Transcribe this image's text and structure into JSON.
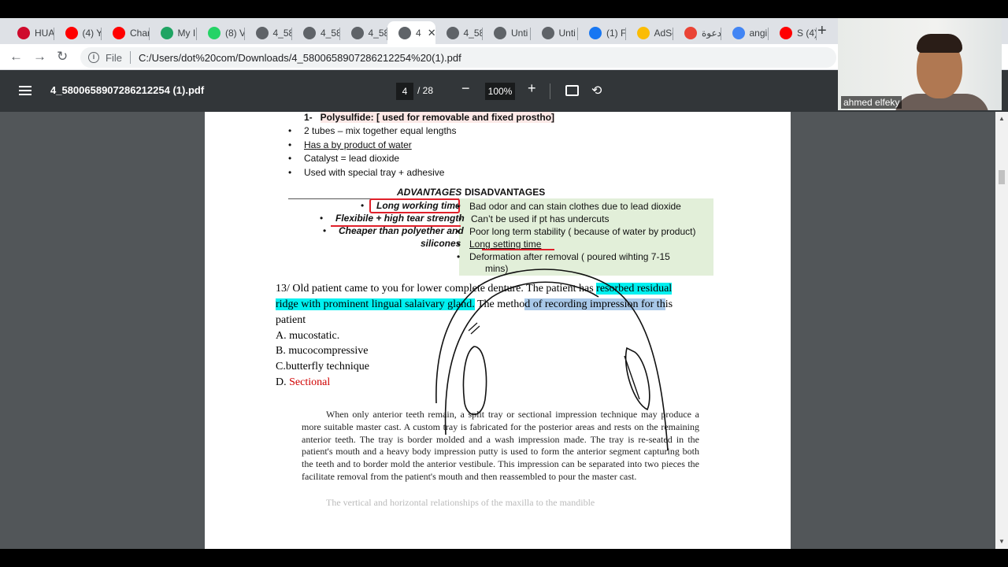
{
  "tabs": [
    {
      "title": "HUA",
      "icon": "huawei-icon",
      "color": "#cf0a2c"
    },
    {
      "title": "(4) Y",
      "icon": "youtube-icon",
      "color": "#ff0000"
    },
    {
      "title": "Char",
      "icon": "youtube-icon",
      "color": "#ff0000"
    },
    {
      "title": "My I",
      "icon": "google-drive-icon",
      "color": "#1fa463"
    },
    {
      "title": "(8) V",
      "icon": "whatsapp-icon",
      "color": "#25d366"
    },
    {
      "title": "4_58",
      "icon": "globe-icon",
      "color": "#5f6368"
    },
    {
      "title": "4_58",
      "icon": "globe-icon",
      "color": "#5f6368"
    },
    {
      "title": "4_58",
      "icon": "globe-icon",
      "color": "#5f6368"
    },
    {
      "title": "4",
      "icon": "globe-icon",
      "color": "#5f6368"
    },
    {
      "title": "4_58",
      "icon": "globe-icon",
      "color": "#5f6368"
    },
    {
      "title": "Unti",
      "icon": "globe-icon",
      "color": "#5f6368"
    },
    {
      "title": "Unti",
      "icon": "globe-icon",
      "color": "#5f6368"
    },
    {
      "title": "(1) F",
      "icon": "facebook-icon",
      "color": "#1877f2"
    },
    {
      "title": "AdSe",
      "icon": "adsense-icon",
      "color": "#fbbc04"
    },
    {
      "title": "دعوة",
      "icon": "gmail-icon",
      "color": "#ea4335"
    },
    {
      "title": "angi",
      "icon": "google-icon",
      "color": "#4285f4"
    },
    {
      "title": "S (4)",
      "icon": "youtube-icon",
      "color": "#ff0000"
    }
  ],
  "address_bar": {
    "scheme_label": "File",
    "url": "C:/Users/dot%20com/Downloads/4_5800658907286212254%20(1).pdf"
  },
  "pdf_toolbar": {
    "title": "4_5800658907286212254 (1).pdf",
    "current_page": "4",
    "total_pages": "/ 28",
    "zoom": "100%"
  },
  "pdf_page": {
    "section_number": "1-",
    "section_title": "Polysulfide: [ used for removable and fixed prostho]",
    "bullets": [
      "2 tubes – mix together equal lengths",
      "Has a by product of water",
      "Catalyst = lead dioxide",
      "Used with special tray + adhesive"
    ],
    "advantages_heading": "ADVANTAGES",
    "disadvantages_heading": "DISADVANTAGES",
    "advantages": [
      "Long working time",
      "Flexibile + high tear strength",
      "Cheaper than polyether and",
      "silicones"
    ],
    "disadvantages": [
      "Bad odor and can stain clothes due to lead dioxide",
      "Can’t be used if pt has undercuts",
      "Poor long term stability ( because of water by product)",
      "Long setting time",
      "Deformation after removal ( poured wihting 7-15",
      "mins)"
    ],
    "question": {
      "part1": "13/ Old patient came to you for lower complete denture. The patient has ",
      "highlight1": "resorbed residual",
      "highlight2": "ridge with prominent lingual salaivary gland.",
      "part2": " The metho",
      "highlight3": "d of recording impression for th",
      "part3": "is",
      "line3": "patient",
      "options": [
        "A. mucostatic.",
        "B. mucocompressive",
        "C.butterfly technique"
      ],
      "answer_prefix": "D. ",
      "answer": "Sectional"
    },
    "paragraph": "When only anterior teeth remain, a split tray or sectional impression technique may produce a more suitable master cast. A custom tray is fabricated for the posterior areas and rests on the remaining anterior teeth. The tray is border molded and a wash impression made. The tray is re-seated in the patient's mouth and a heavy body impression putty is used to form the anterior segment capturing both the teeth and to border mold the anterior vestibule. This impression can be separated into two pieces the facilitate removal from the patient's mouth and then reassembled to pour the master cast.",
    "faded_line": "The vertical and horizontal relationships of the maxilla to the mandible"
  },
  "webcam": {
    "name": "ahmed elfeky"
  }
}
